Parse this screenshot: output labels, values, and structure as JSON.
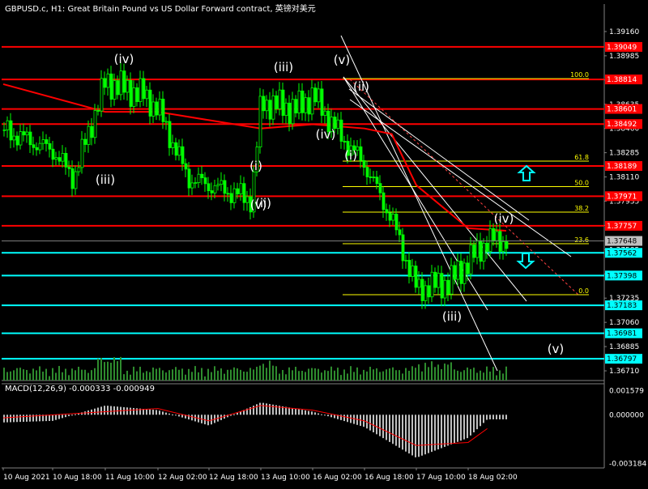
{
  "header": {
    "symbol_title": "GBPUSD.c, H1:  Great Britain Pound vs US Dollar Forward contract, 英镑对美元"
  },
  "macd_panel": {
    "label": "MACD(12,26,9) -0.000333 -0.000949"
  },
  "colors": {
    "background": "#000000",
    "candle": "#00ff00",
    "ma": "#ff0000",
    "resistance_level": "#ff0000",
    "support_level": "#00ffff",
    "fib": "#ffff00",
    "channel": "#ffffff",
    "macd_hist": "#c0c0c0",
    "macd_signal": "#ff0000",
    "current_price_tag": "#c0c0c0",
    "volume": "#2e8b2e"
  },
  "chart_data": {
    "type": "line",
    "title": "GBPUSD.c, H1:  Great Britain Pound vs US Dollar Forward contract, 英镑对美元",
    "price_axis_ticks": [
      "1.39160",
      "1.38985",
      "1.38810",
      "1.38635",
      "1.38460",
      "1.38285",
      "1.38110",
      "1.37935",
      "1.37760",
      "1.37585",
      "1.37410",
      "1.37235",
      "1.37060",
      "1.36885",
      "1.36710"
    ],
    "price_range": [
      1.3664,
      1.393
    ],
    "time_axis_labels": [
      "10 Aug 2021",
      "10 Aug 18:00",
      "11 Aug 10:00",
      "12 Aug 02:00",
      "12 Aug 18:00",
      "13 Aug 10:00",
      "16 Aug 02:00",
      "16 Aug 18:00",
      "17 Aug 10:00",
      "18 Aug 02:00"
    ],
    "series": [
      {
        "name": "",
        "type": "line",
        "approx_close_points": [
          [
            "10 Aug 2021",
            1.3845
          ],
          [
            "10 Aug 18:00",
            1.383
          ],
          [
            "10 Aug 22:00",
            1.381
          ],
          [
            "11 Aug 10:00",
            1.388
          ],
          [
            "11 Aug 20:00",
            1.387
          ],
          [
            "12 Aug 02:00",
            1.386
          ],
          [
            "12 Aug 10:00",
            1.381
          ],
          [
            "12 Aug 18:00",
            1.3805
          ],
          [
            "13 Aug 06:00",
            1.3795
          ],
          [
            "13 Aug 10:00",
            1.3865
          ],
          [
            "13 Aug 20:00",
            1.386
          ],
          [
            "16 Aug 02:00",
            1.387
          ],
          [
            "16 Aug 10:00",
            1.384
          ],
          [
            "16 Aug 18:00",
            1.382
          ],
          [
            "17 Aug 02:00",
            1.378
          ],
          [
            "17 Aug 10:00",
            1.373
          ],
          [
            "17 Aug 20:00",
            1.3735
          ],
          [
            "18 Aug 02:00",
            1.375
          ],
          [
            "18 Aug 08:00",
            1.3765
          ]
        ]
      },
      {
        "name": "",
        "type": "line",
        "approx_points": [
          [
            "10 Aug 2021",
            1.3878
          ],
          [
            "11 Aug 10:00",
            1.3858
          ],
          [
            "12 Aug 02:00",
            1.3858
          ],
          [
            "12 Aug 18:00",
            1.3852
          ],
          [
            "13 Aug 10:00",
            1.3846
          ],
          [
            "16 Aug 02:00",
            1.3849
          ],
          [
            "16 Aug 18:00",
            1.3846
          ],
          [
            "17 Aug 02:00",
            1.3842
          ],
          [
            "17 Aug 10:00",
            1.3805
          ],
          [
            "18 Aug 02:00",
            1.3774
          ]
        ]
      }
    ],
    "current_price": "1.37648",
    "horizontal_levels": [
      {
        "value": "1.39049",
        "kind": "resistance",
        "color": "#ff0000"
      },
      {
        "value": "1.38814",
        "kind": "resistance",
        "color": "#ff0000"
      },
      {
        "value": "1.38601",
        "kind": "resistance",
        "color": "#ff0000"
      },
      {
        "value": "1.38492",
        "kind": "resistance",
        "color": "#ff0000"
      },
      {
        "value": "1.38189",
        "kind": "resistance",
        "color": "#ff0000"
      },
      {
        "value": "1.37971",
        "kind": "resistance",
        "color": "#ff0000"
      },
      {
        "value": "1.37757",
        "kind": "resistance",
        "color": "#ff0000"
      },
      {
        "value": "1.37562",
        "kind": "support",
        "color": "#00ffff"
      },
      {
        "value": "1.37398",
        "kind": "support",
        "color": "#00ffff"
      },
      {
        "value": "1.37183",
        "kind": "support",
        "color": "#00ffff"
      },
      {
        "value": "1.36981",
        "kind": "support",
        "color": "#00ffff"
      },
      {
        "value": "1.36797",
        "kind": "support",
        "color": "#00ffff"
      }
    ],
    "fibonacci_levels": [
      "100.0",
      "61.8",
      "50.0",
      "38.2",
      "23.6",
      "0.0"
    ],
    "wave_labels": [
      "(iv)",
      "(iii)",
      "(v)",
      "(iii)",
      "(ii)",
      "(iv)",
      "(i)",
      "(i)",
      "(v)",
      "(ii)",
      "(iv)",
      "(iii)",
      "(v)"
    ],
    "annotations": [
      "buy-arrow-up",
      "sell-arrow-down"
    ],
    "macd": {
      "label": "MACD(12,26,9) -0.000333 -0.000949",
      "axis_ticks": [
        "0.001579",
        "0.000000",
        "-0.003184"
      ],
      "range": [
        -0.00325,
        0.0017
      ],
      "histogram_profile": [
        [
          "10 Aug 2021",
          -0.0005
        ],
        [
          "10 Aug 18:00",
          -0.0004
        ],
        [
          "11 Aug 10:00",
          0.0006
        ],
        [
          "12 Aug 02:00",
          0.0003
        ],
        [
          "12 Aug 18:00",
          -0.0007
        ],
        [
          "13 Aug 10:00",
          0.0008
        ],
        [
          "16 Aug 02:00",
          0.0002
        ],
        [
          "16 Aug 18:00",
          -0.0008
        ],
        [
          "17 Aug 10:00",
          -0.0028
        ],
        [
          "18 Aug 02:00",
          -0.0015
        ],
        [
          "18 Aug 08:00",
          -0.0003
        ]
      ],
      "signal_profile": [
        [
          "10 Aug 2021",
          -0.0002
        ],
        [
          "11 Aug 10:00",
          0.0002
        ],
        [
          "12 Aug 02:00",
          0.0004
        ],
        [
          "12 Aug 18:00",
          -0.0004
        ],
        [
          "13 Aug 10:00",
          0.0006
        ],
        [
          "16 Aug 02:00",
          0.0003
        ],
        [
          "16 Aug 18:00",
          -0.0004
        ],
        [
          "17 Aug 10:00",
          -0.002
        ],
        [
          "18 Aug 02:00",
          -0.0018
        ],
        [
          "18 Aug 08:00",
          -0.0009
        ]
      ]
    },
    "grid": false,
    "legend": "none"
  }
}
